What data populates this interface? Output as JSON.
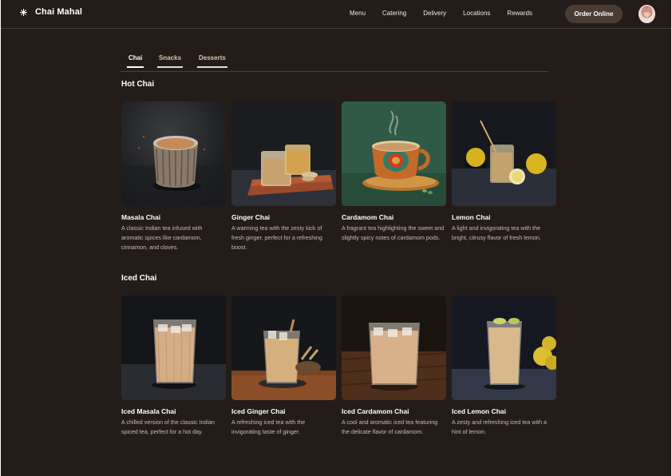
{
  "header": {
    "brand": "Chai Mahal",
    "nav": [
      "Menu",
      "Catering",
      "Delivery",
      "Locations",
      "Rewards"
    ],
    "order_button": "Order Online"
  },
  "tabs": [
    {
      "label": "Chai",
      "active": true
    },
    {
      "label": "Snacks",
      "active": false
    },
    {
      "label": "Desserts",
      "active": false
    }
  ],
  "sections": [
    {
      "title": "Hot Chai",
      "items": [
        {
          "name": "Masala Chai",
          "description": "A classic Indian tea infused with aromatic spices like cardamom, cinnamon, and cloves."
        },
        {
          "name": "Ginger Chai",
          "description": "A warming tea with the zesty kick of fresh ginger, perfect for a refreshing boost."
        },
        {
          "name": "Cardamom Chai",
          "description": "A fragrant tea highlighting the sweet and slightly spicy notes of cardamom pods."
        },
        {
          "name": "Lemon Chai",
          "description": "A light and invigorating tea with the bright, citrusy flavor of fresh lemon."
        }
      ]
    },
    {
      "title": "Iced Chai",
      "items": [
        {
          "name": "Iced Masala Chai",
          "description": "A chilled version of the classic Indian spiced tea, perfect for a hot day."
        },
        {
          "name": "Iced Ginger Chai",
          "description": "A refreshing iced tea with the invigorating taste of ginger."
        },
        {
          "name": "Iced Cardamom Chai",
          "description": "A cool and aromatic iced tea featuring the delicate flavor of cardamom."
        },
        {
          "name": "Iced Lemon Chai",
          "description": "A zesty and refreshing iced tea with a hint of lemon."
        }
      ]
    }
  ],
  "colors": {
    "background": "#241c19",
    "button": "#4a3c33",
    "accent_tab": "#d9c3a4"
  }
}
